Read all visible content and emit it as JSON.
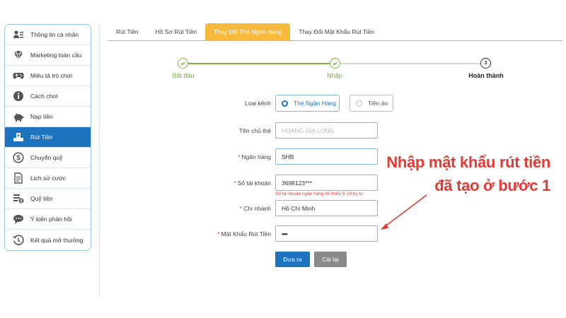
{
  "sidebar": {
    "items": [
      {
        "label": "Thông tin cá nhân",
        "icon": "user-card-icon"
      },
      {
        "label": "Marketing toàn cầu",
        "icon": "diamond-icon"
      },
      {
        "label": "Miêu tả trò chơi",
        "icon": "gamepad-icon"
      },
      {
        "label": "Cách chơi",
        "icon": "info-icon"
      },
      {
        "label": "Nạp tiền",
        "icon": "piggy-bank-icon"
      },
      {
        "label": "Rút Tiền",
        "icon": "withdraw-icon",
        "active": true
      },
      {
        "label": "Chuyển quỹ",
        "icon": "dollar-icon"
      },
      {
        "label": "Lịch sử cược",
        "icon": "history-document-icon"
      },
      {
        "label": "Quỹ tiền",
        "icon": "fund-list-icon"
      },
      {
        "label": "Ý kiến phản hồi",
        "icon": "chat-bubble-icon"
      },
      {
        "label": "Kết quả mở thưởng",
        "icon": "clock-history-icon"
      }
    ]
  },
  "tabs": [
    {
      "label": "Rút Tiền"
    },
    {
      "label": "Hồ Sơ Rút Tiền"
    },
    {
      "label": "Thay Đổi Thẻ Ngân Hàng",
      "active": true
    },
    {
      "label": "Thay Đổi Mật Khẩu Rút Tiền"
    }
  ],
  "steps": [
    {
      "label": "Bắt đầu",
      "state": "done"
    },
    {
      "label": "Nhập",
      "state": "done"
    },
    {
      "label": "Hoàn thành",
      "number": "3",
      "state": "current"
    }
  ],
  "form": {
    "channel": {
      "label": "Loại kênh",
      "options": [
        "Thẻ Ngân Hàng",
        "Tiền ảo"
      ],
      "selected": "Thẻ Ngân Hàng"
    },
    "holder": {
      "label": "Tên chủ thẻ",
      "placeholder": "HOANG GIA LONG"
    },
    "bank": {
      "label": "Ngân hàng",
      "value": "SHB"
    },
    "account": {
      "label": "Số tài khoản",
      "value": "3698123***",
      "hint": "Số tài khoản ngân hàng tối thiểu 5-19 ký tự"
    },
    "branch": {
      "label": "Chi nhánh",
      "value": "Hồ Chí Minh"
    },
    "password": {
      "label": "Mật Khẩu Rút Tiền",
      "value": "••••"
    },
    "submit_label": "Đưa ra",
    "reset_label": "Cài lại"
  },
  "annotation": {
    "line1": "Nhập mật khẩu rút tiền",
    "line2": "đã tạo ở bước 1",
    "color": "#e53935"
  },
  "colors": {
    "accent": "#1e73be",
    "tab_active": "#f7b93b",
    "step_done": "#7cb342",
    "required": "#e53935"
  }
}
